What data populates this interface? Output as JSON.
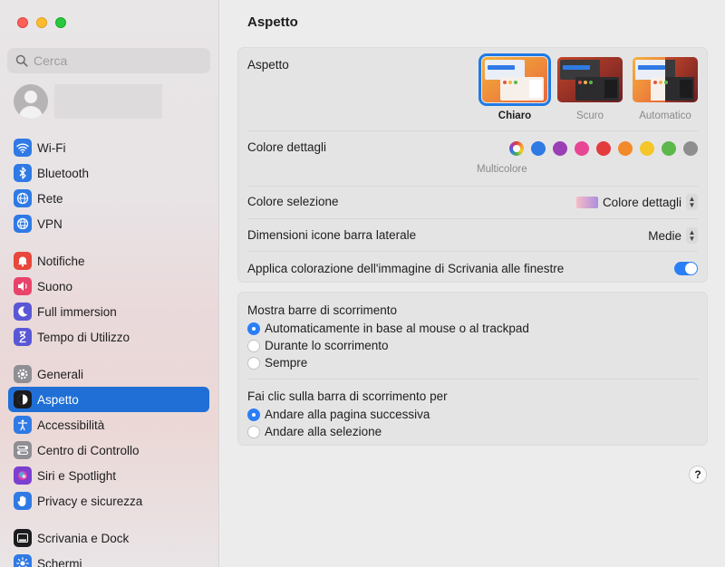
{
  "window": {
    "title": "Aspetto"
  },
  "search": {
    "placeholder": "Cerca"
  },
  "sidebar": {
    "groups": [
      [
        {
          "label": "Wi-Fi",
          "icon": "wifi-icon",
          "color": "#2f7ae5"
        },
        {
          "label": "Bluetooth",
          "icon": "bluetooth-icon",
          "color": "#2f7ae5"
        },
        {
          "label": "Rete",
          "icon": "globe-icon",
          "color": "#2f7ae5"
        },
        {
          "label": "VPN",
          "icon": "vpn-icon",
          "color": "#2f7ae5"
        }
      ],
      [
        {
          "label": "Notifiche",
          "icon": "bell-icon",
          "color": "#e8473c"
        },
        {
          "label": "Suono",
          "icon": "speaker-icon",
          "color": "#e9436b"
        },
        {
          "label": "Full immersion",
          "icon": "moon-icon",
          "color": "#5a57d6"
        },
        {
          "label": "Tempo di Utilizzo",
          "icon": "hourglass-icon",
          "color": "#5a57d6"
        }
      ],
      [
        {
          "label": "Generali",
          "icon": "gear-icon",
          "color": "#8e8e93"
        },
        {
          "label": "Aspetto",
          "icon": "appearance-icon",
          "color": "#1c1c1e",
          "active": true
        },
        {
          "label": "Accessibilità",
          "icon": "accessibility-icon",
          "color": "#2f7ae5"
        },
        {
          "label": "Centro di Controllo",
          "icon": "control-center-icon",
          "color": "#8e8e93"
        },
        {
          "label": "Siri e Spotlight",
          "icon": "siri-icon",
          "color": "#7b3fd1"
        },
        {
          "label": "Privacy e sicurezza",
          "icon": "hand-icon",
          "color": "#2f7ae5"
        }
      ],
      [
        {
          "label": "Scrivania e Dock",
          "icon": "dock-icon",
          "color": "#1c1c1e"
        },
        {
          "label": "Schermi",
          "icon": "display-icon",
          "color": "#2f7ae5"
        }
      ]
    ]
  },
  "main": {
    "appearance": {
      "label": "Aspetto",
      "options": [
        {
          "label": "Chiaro",
          "selected": true
        },
        {
          "label": "Scuro",
          "selected": false
        },
        {
          "label": "Automatico",
          "selected": false
        }
      ]
    },
    "accent": {
      "label": "Colore dettagli",
      "selected_label": "Multicolore",
      "colors": [
        "#2f7ae5",
        "#9b3fb5",
        "#e84695",
        "#e23c3c",
        "#f28a2b",
        "#f5c628",
        "#5cb84a",
        "#8e8e8e"
      ]
    },
    "highlight": {
      "label": "Colore selezione",
      "value": "Colore dettagli"
    },
    "sidebar_icon_size": {
      "label": "Dimensioni icone barra laterale",
      "value": "Medie"
    },
    "wallpaper_tinting": {
      "label": "Applica colorazione dell'immagine di Scrivania alle finestre",
      "enabled": true
    },
    "scroll_bars": {
      "label": "Mostra barre di scorrimento",
      "options": [
        {
          "label": "Automaticamente in base al mouse o al trackpad",
          "checked": true
        },
        {
          "label": "Durante lo scorrimento",
          "checked": false
        },
        {
          "label": "Sempre",
          "checked": false
        }
      ]
    },
    "click_scroll": {
      "label": "Fai clic sulla barra di scorrimento per",
      "options": [
        {
          "label": "Andare alla pagina successiva",
          "checked": true
        },
        {
          "label": "Andare alla selezione",
          "checked": false
        }
      ]
    },
    "help": "?"
  }
}
